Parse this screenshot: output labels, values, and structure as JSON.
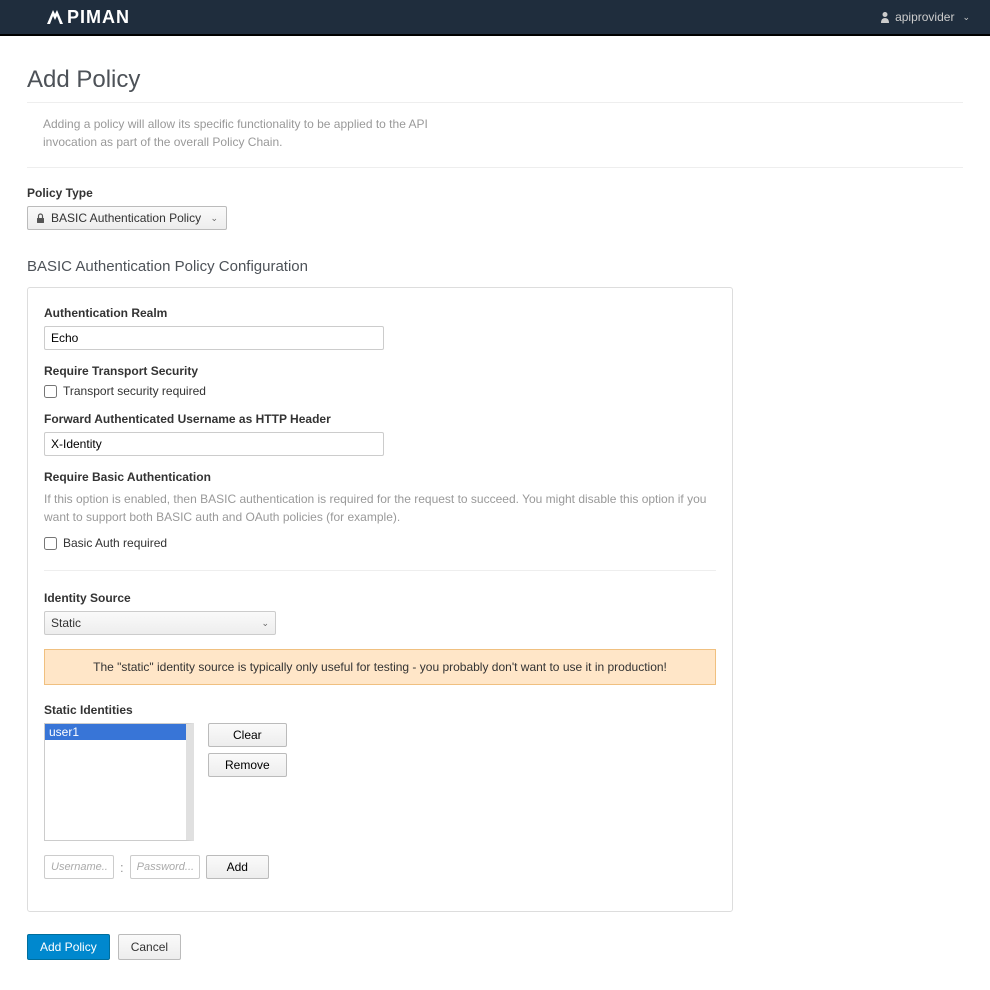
{
  "navbar": {
    "logo_text": "PIMAN",
    "username": "apiprovider"
  },
  "page": {
    "title": "Add Policy",
    "description": "Adding a policy will allow its specific functionality to be applied to the API invocation as part of the overall Policy Chain."
  },
  "policyType": {
    "label": "Policy Type",
    "selected": "BASIC Authentication Policy"
  },
  "config": {
    "heading": "BASIC Authentication Policy Configuration",
    "realm": {
      "label": "Authentication Realm",
      "value": "Echo"
    },
    "transport": {
      "label": "Require Transport Security",
      "checkbox_label": "Transport security required",
      "checked": false
    },
    "forward": {
      "label": "Forward Authenticated Username as HTTP Header",
      "value": "X-Identity"
    },
    "basicAuth": {
      "label": "Require Basic Authentication",
      "help": "If this option is enabled, then BASIC authentication is required for the request to succeed. You might disable this option if you want to support both BASIC auth and OAuth policies (for example).",
      "checkbox_label": "Basic Auth required",
      "checked": false
    },
    "identitySource": {
      "label": "Identity Source",
      "selected": "Static",
      "warning": "The \"static\" identity source is typically only useful for testing - you probably don't want to use it in production!"
    },
    "staticIdentities": {
      "label": "Static Identities",
      "items": [
        "user1"
      ],
      "selected_index": 0,
      "clear_label": "Clear",
      "remove_label": "Remove",
      "username_placeholder": "Username..",
      "password_placeholder": "Password...",
      "add_label": "Add"
    }
  },
  "footer": {
    "add_policy": "Add Policy",
    "cancel": "Cancel"
  }
}
